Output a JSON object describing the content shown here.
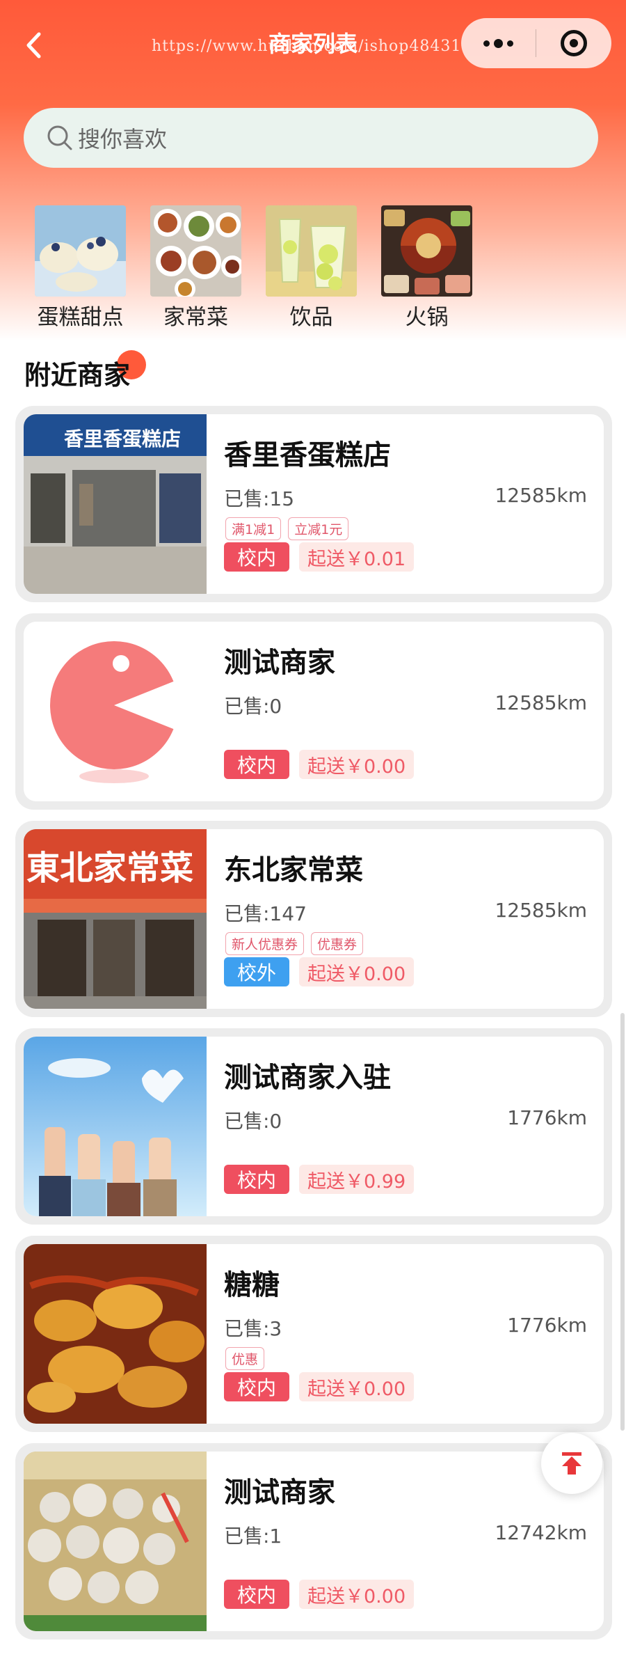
{
  "header": {
    "title": "商家列表",
    "watermark": "https://www.huzhan.com/ishop48431"
  },
  "search": {
    "placeholder": "搜你喜欢"
  },
  "categories": [
    {
      "label": "蛋糕甜点",
      "icon": "cake-photo"
    },
    {
      "label": "家常菜",
      "icon": "home-dishes-photo"
    },
    {
      "label": "饮品",
      "icon": "drinks-photo"
    },
    {
      "label": "火锅",
      "icon": "hotpot-photo"
    }
  ],
  "section": {
    "title": "附近商家"
  },
  "shops": [
    {
      "name": "香里香蛋糕店",
      "sold": "已售:15",
      "distance": "12585km",
      "promos": [
        "满1减1",
        "立减1元"
      ],
      "tag": "校内",
      "tag_color": "#ef4f5f",
      "fee": "起送￥0.01",
      "image": "cake-shop-storefront"
    },
    {
      "name": "测试商家",
      "sold": "已售:0",
      "distance": "12585km",
      "promos": [],
      "tag": "校内",
      "tag_color": "#ef4f5f",
      "fee": "起送￥0.00",
      "image": "red-ball-logo"
    },
    {
      "name": "东北家常菜",
      "sold": "已售:147",
      "distance": "12585km",
      "promos": [
        "新人优惠券",
        "优惠券"
      ],
      "tag": "校外",
      "tag_color": "#3ea0f0",
      "fee": "起送￥0.00",
      "image": "restaurant-storefront"
    },
    {
      "name": "测试商家入驻",
      "sold": "已售:0",
      "distance": "1776km",
      "promos": [],
      "tag": "校内",
      "tag_color": "#ef4f5f",
      "fee": "起送￥0.99",
      "image": "hands-sky-illustration"
    },
    {
      "name": "糖糖",
      "sold": "已售:3",
      "distance": "1776km",
      "promos": [
        "优惠"
      ],
      "tag": "校内",
      "tag_color": "#ef4f5f",
      "fee": "起送￥0.00",
      "image": "fried-food-photo"
    },
    {
      "name": "测试商家",
      "sold": "已售:1",
      "distance": "12742km",
      "promos": [],
      "tag": "校内",
      "tag_color": "#ef4f5f",
      "fee": "起送￥0.00",
      "image": "meatballs-photo"
    }
  ]
}
